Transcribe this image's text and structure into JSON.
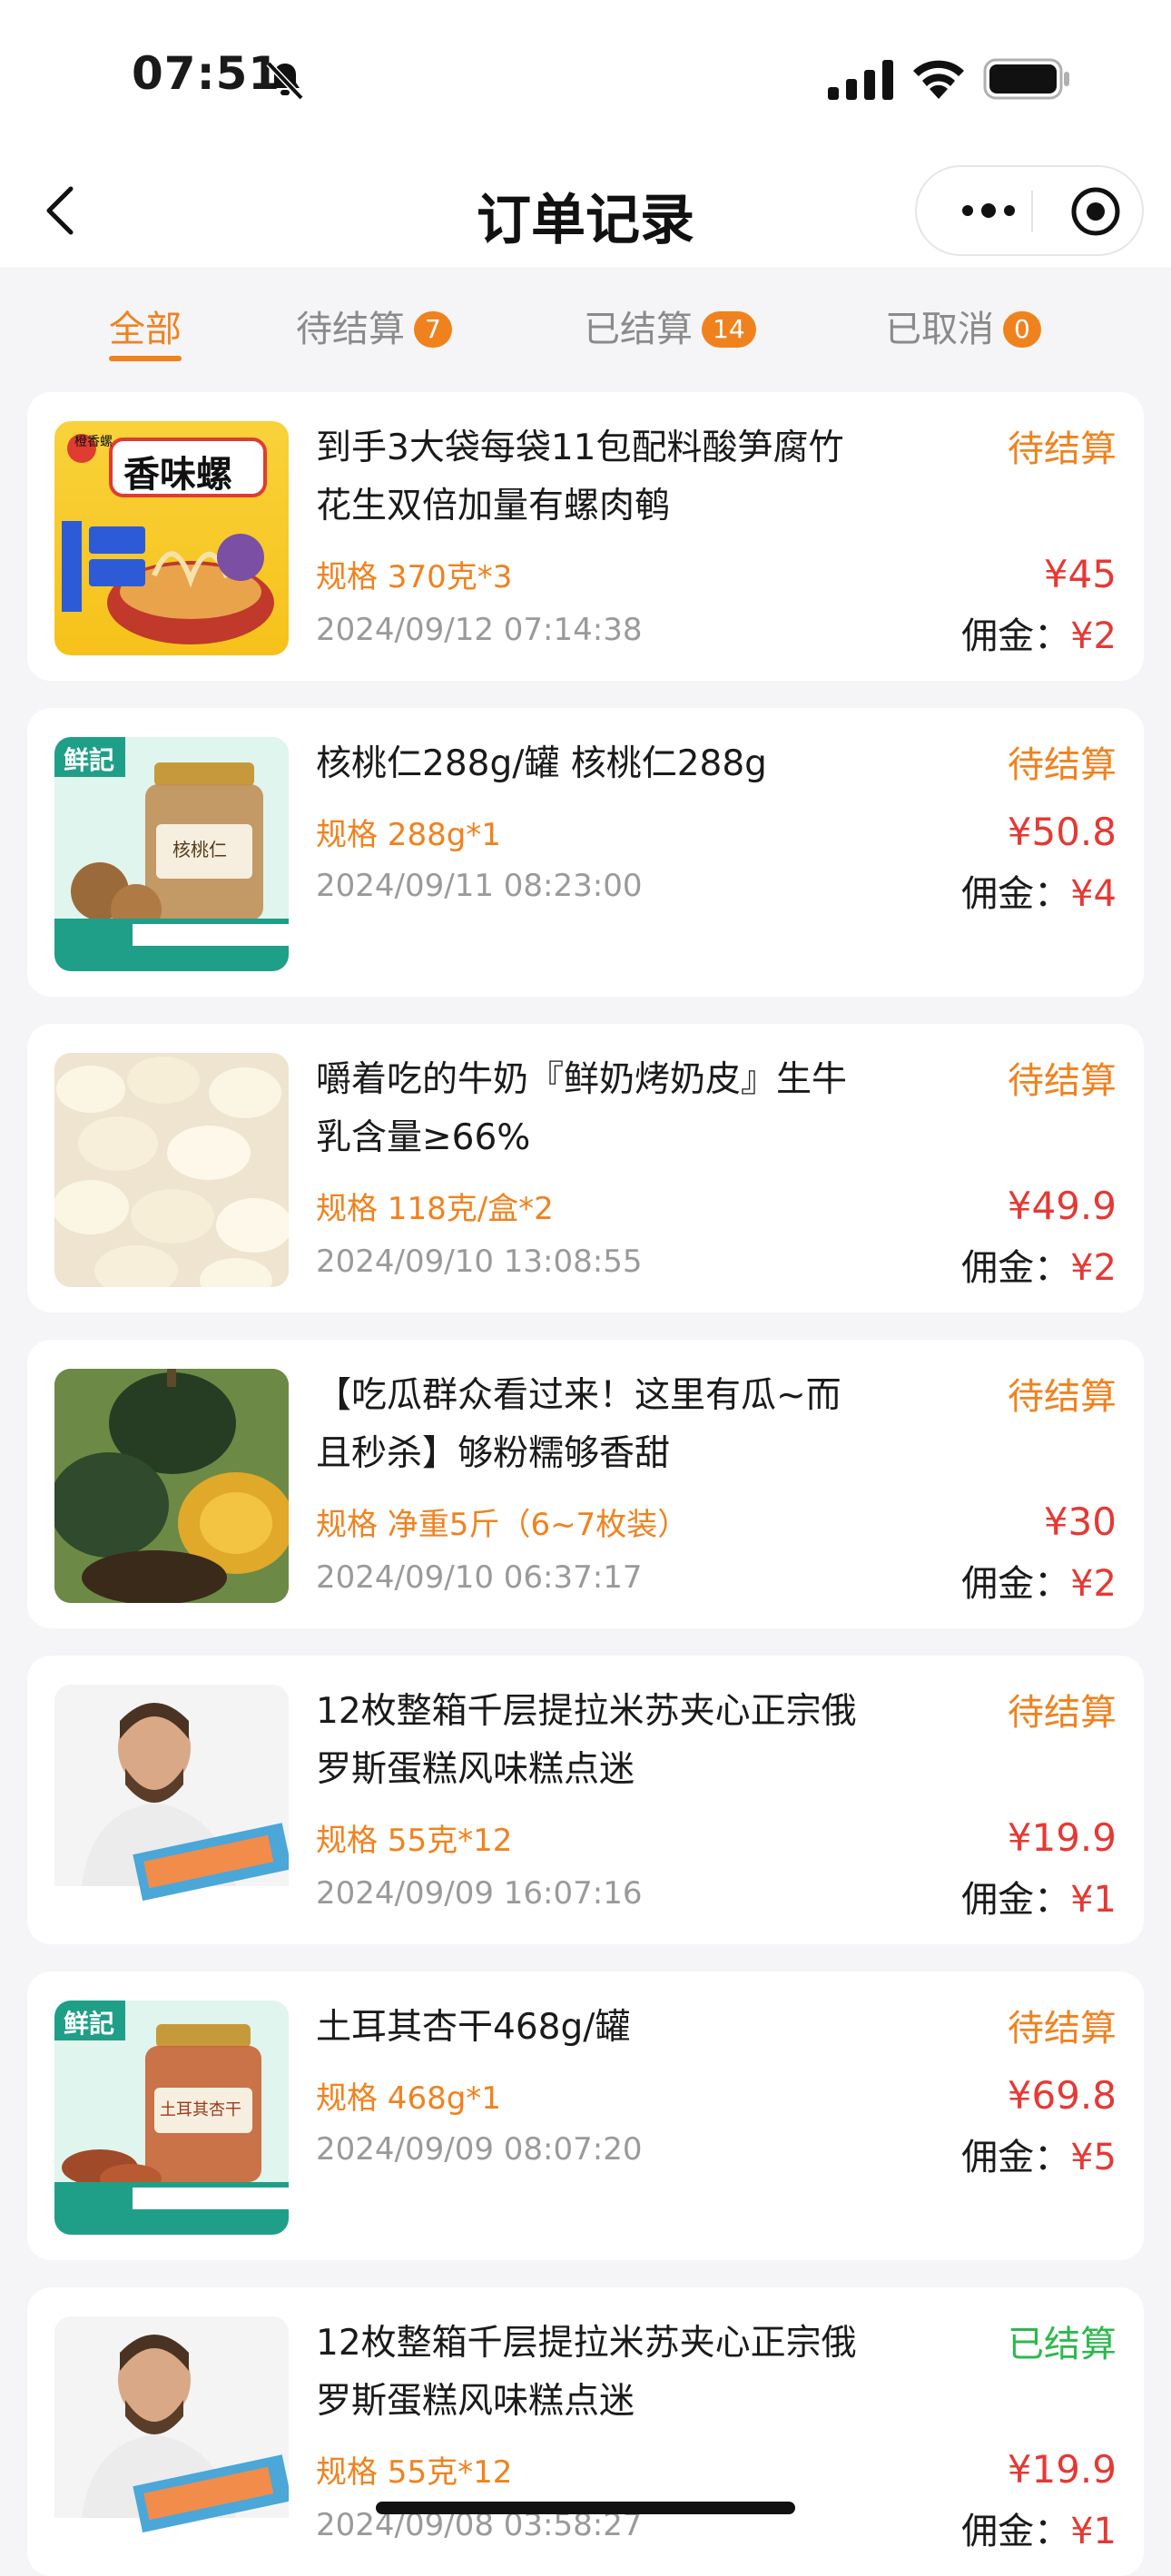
{
  "status_bar": {
    "time": "07:51"
  },
  "nav": {
    "title": "订单记录"
  },
  "tabs": [
    {
      "label": "全部",
      "active": true
    },
    {
      "label": "待结算",
      "count": "7"
    },
    {
      "label": "已结算",
      "count": "14"
    },
    {
      "label": "已取消",
      "count": "0"
    }
  ],
  "orders": [
    {
      "title": "到手3大袋每袋11包配料酸笋腐竹花生双倍加量有螺肉鹌",
      "spec": "规格 370克*3",
      "date": "2024/09/12 07:14:38",
      "status": "待结算",
      "price": "¥45",
      "commission_label": "佣金：",
      "commission": "¥2",
      "thumb_text": "香味螺",
      "thumb_brand": "橙香螺"
    },
    {
      "title": "核桃仁288g/罐 核桃仁288g",
      "spec": "规格 288g*1",
      "date": "2024/09/11 08:23:00",
      "status": "待结算",
      "price": "¥50.8",
      "commission_label": "佣金：",
      "commission": "¥4",
      "thumb_text": "核桃仁",
      "thumb_brand": "鲜記"
    },
    {
      "title": "嚼着吃的牛奶『鲜奶烤奶皮』生牛乳含量≥66%",
      "spec": "规格 118克/盒*2",
      "date": "2024/09/10 13:08:55",
      "status": "待结算",
      "price": "¥49.9",
      "commission_label": "佣金：",
      "commission": "¥2"
    },
    {
      "title": "【吃瓜群众看过来！这里有瓜~而且秒杀】够粉糯够香甜",
      "spec": "规格 净重5斤（6~7枚装）",
      "date": "2024/09/10 06:37:17",
      "status": "待结算",
      "price": "¥30",
      "commission_label": "佣金：",
      "commission": "¥2"
    },
    {
      "title": "12枚整箱千层提拉米苏夹心正宗俄罗斯蛋糕风味糕点迷",
      "spec": "规格 55克*12",
      "date": "2024/09/09 16:07:16",
      "status": "待结算",
      "price": "¥19.9",
      "commission_label": "佣金：",
      "commission": "¥1"
    },
    {
      "title": "土耳其杏干468g/罐",
      "spec": "规格 468g*1",
      "date": "2024/09/09 08:07:20",
      "status": "待结算",
      "price": "¥69.8",
      "commission_label": "佣金：",
      "commission": "¥5",
      "thumb_text": "土耳其杏干",
      "thumb_brand": "鲜記"
    },
    {
      "title": "12枚整箱千层提拉米苏夹心正宗俄罗斯蛋糕风味糕点迷",
      "spec": "规格 55克*12",
      "date": "2024/09/08 03:58:27",
      "status": "已结算",
      "price": "¥19.9",
      "commission_label": "佣金：",
      "commission": "¥1"
    }
  ],
  "colors": {
    "accent": "#f0821e",
    "price": "#e53935",
    "settled": "#2db84d",
    "background": "#f5f5f7"
  }
}
